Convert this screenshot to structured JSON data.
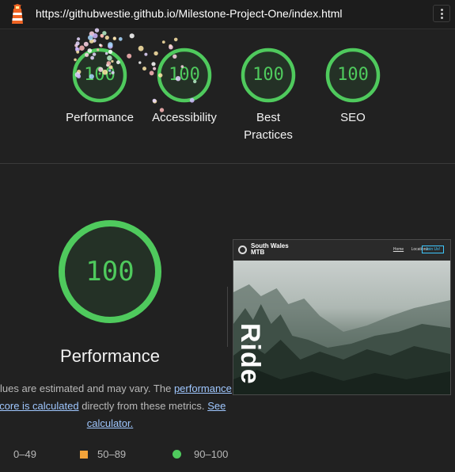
{
  "header": {
    "url": "https://githubwestie.github.io/Milestone-Project-One/index.html"
  },
  "colors": {
    "pass": "#4fca5d",
    "average": "#f3a33a",
    "fail": "#e74c3c"
  },
  "gauges": [
    {
      "label": "Performance",
      "score": "100"
    },
    {
      "label": "Accessibility",
      "score": "100"
    },
    {
      "label": "Best Practices",
      "score": "100"
    },
    {
      "label": "SEO",
      "score": "100"
    }
  ],
  "performance": {
    "score": "100",
    "title": "Performance",
    "desc_pre": "Values are estimated and may vary. The",
    "desc_link": "performance score is calculated",
    "desc_mid": "directly from these metrics.",
    "desc_link2": "See calculator."
  },
  "screenshot": {
    "brand": "South Wales MTB",
    "nav_home": "Home",
    "nav_locations": "Locations",
    "nav_button": "Join Us!",
    "hero_word": "Ride"
  },
  "legend": [
    {
      "range": "0–49",
      "icon": "triangle-icon"
    },
    {
      "range": "50–89",
      "icon": "square-icon"
    },
    {
      "range": "90–100",
      "icon": "circle-icon"
    }
  ]
}
